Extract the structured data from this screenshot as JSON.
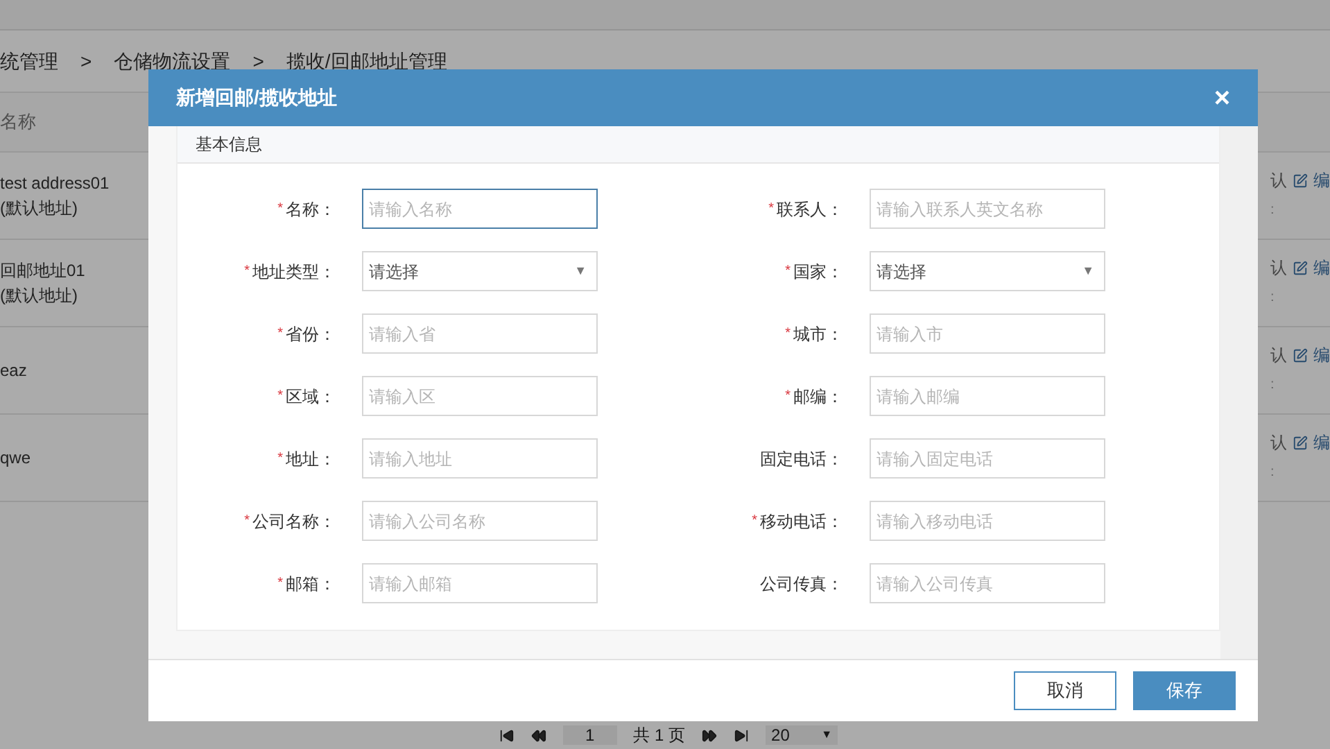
{
  "breadcrumb": [
    "统管理",
    ">",
    "仓储物流设置",
    ">",
    "揽收/回邮地址管理"
  ],
  "table": {
    "columns": [
      "名称"
    ],
    "rows": [
      {
        "name": "test address01",
        "note": "(默认地址)",
        "action_1": "认",
        "action_2": "编",
        "extra": ":"
      },
      {
        "name": "回邮地址01",
        "note": "(默认地址)",
        "action_1": "认",
        "action_2": "编",
        "extra": ":"
      },
      {
        "name": "eaz",
        "action_1": "认",
        "action_2": "编",
        "extra": ":"
      },
      {
        "name": "qwe",
        "action_1": "认",
        "action_2": "编",
        "extra": ":"
      }
    ]
  },
  "pagination": {
    "page": "1",
    "total": "共 1 页",
    "page_size": "20",
    "caret": "▼"
  },
  "dialog": {
    "title": "新增回邮/揽收地址",
    "close": "×",
    "section": "基本信息",
    "fields": [
      {
        "label": "名称：",
        "required": true,
        "kind": "input",
        "placeholder": "请输入名称",
        "focused": true
      },
      {
        "label": "联系人：",
        "required": true,
        "kind": "input",
        "placeholder": "请输入联系人英文名称",
        "focused": false
      },
      {
        "label": "地址类型：",
        "required": true,
        "kind": "select",
        "value": "请选择",
        "caret": "▼"
      },
      {
        "label": "国家：",
        "required": true,
        "kind": "select",
        "value": "请选择",
        "caret": "▼"
      },
      {
        "label": "省份：",
        "required": true,
        "kind": "input",
        "placeholder": "请输入省",
        "focused": false
      },
      {
        "label": "城市：",
        "required": true,
        "kind": "input",
        "placeholder": "请输入市",
        "focused": false
      },
      {
        "label": "区域：",
        "required": true,
        "kind": "input",
        "placeholder": "请输入区",
        "focused": false
      },
      {
        "label": "邮编：",
        "required": true,
        "kind": "input",
        "placeholder": "请输入邮编",
        "focused": false
      },
      {
        "label": "地址：",
        "required": true,
        "kind": "input",
        "placeholder": "请输入地址",
        "focused": false
      },
      {
        "label": "固定电话：",
        "required": false,
        "kind": "input",
        "placeholder": "请输入固定电话",
        "focused": false
      },
      {
        "label": "公司名称：",
        "required": true,
        "kind": "input",
        "placeholder": "请输入公司名称",
        "focused": false
      },
      {
        "label": "移动电话：",
        "required": true,
        "kind": "input",
        "placeholder": "请输入移动电话",
        "focused": false
      },
      {
        "label": "邮箱：",
        "required": true,
        "kind": "input",
        "placeholder": "请输入邮箱",
        "focused": false
      },
      {
        "label": "公司传真：",
        "required": false,
        "kind": "input",
        "placeholder": "请输入公司传真",
        "focused": false
      }
    ],
    "required_mark": "*",
    "buttons": [
      {
        "label": "取消",
        "kind": "secondary"
      },
      {
        "label": "保存",
        "kind": "primary"
      }
    ]
  }
}
